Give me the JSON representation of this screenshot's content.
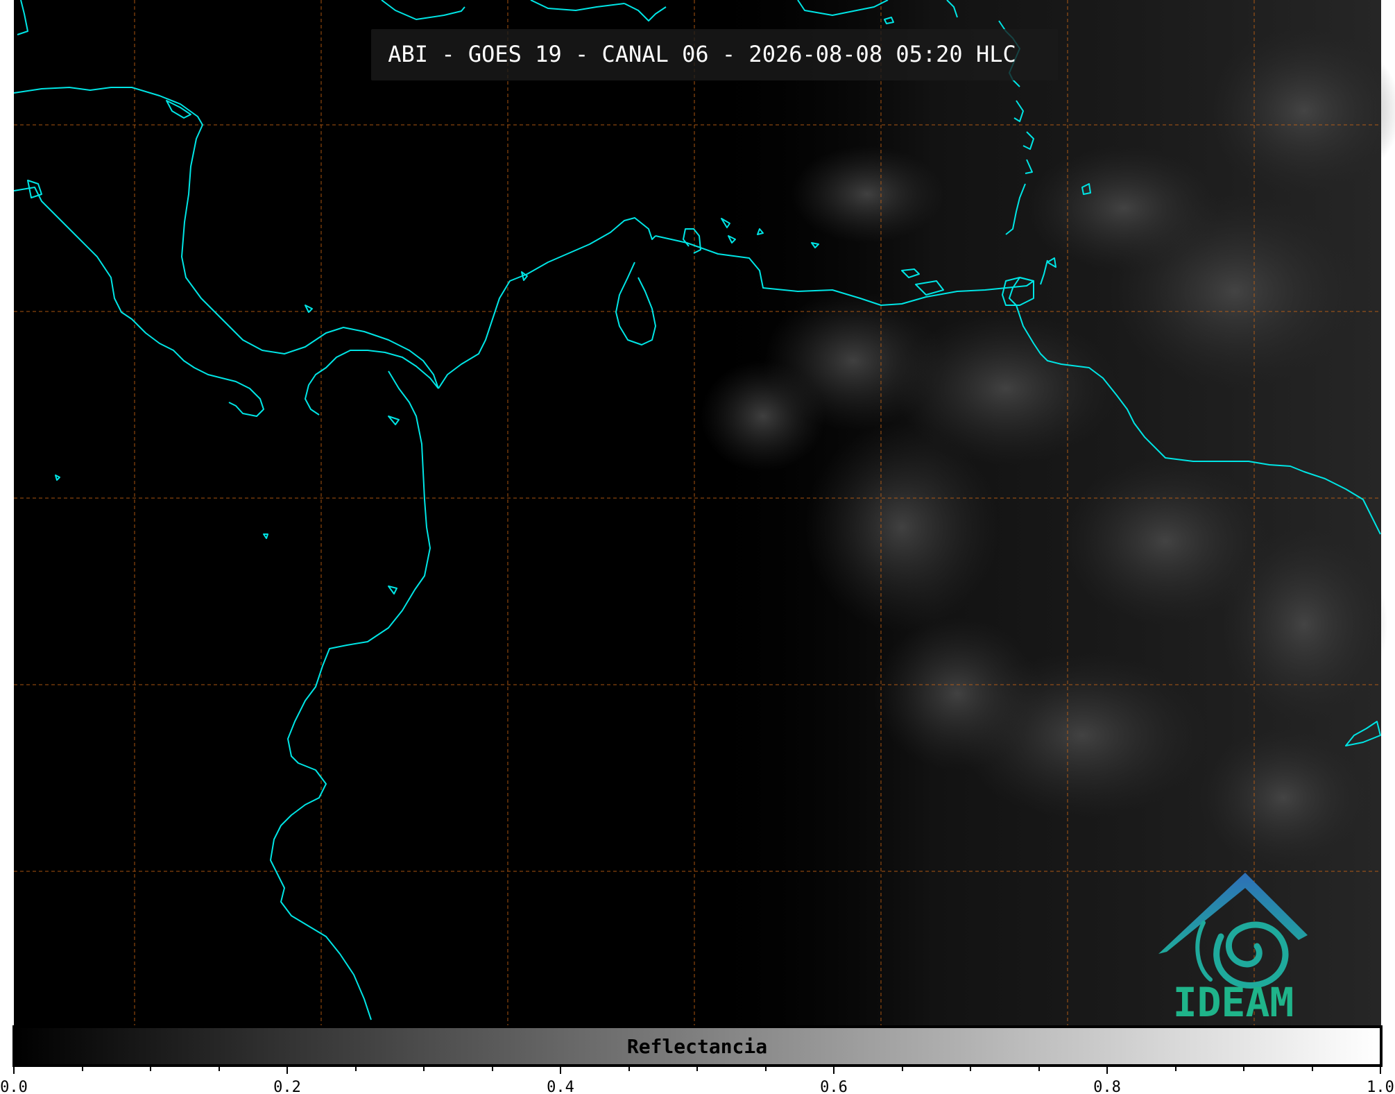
{
  "title": "ABI - GOES 19 - CANAL 06 - 2026-08-08 05:20 HLC",
  "colorbar": {
    "label": "Reflectancia",
    "ticks": [
      "0.0",
      "0.2",
      "0.4",
      "0.6",
      "0.8",
      "1.0"
    ],
    "range": [
      0.0,
      1.0
    ],
    "colormap": "grayscale black-to-white"
  },
  "logo": {
    "text": "IDEAM",
    "colors": {
      "text": "#1fb48a",
      "roof": "#2e6fb8",
      "swirl": "#1faa9c"
    }
  },
  "colors": {
    "background": "#000000",
    "coastline": "#00e5e5",
    "grid": "#c86414",
    "title_text": "#ffffff"
  },
  "grid": {
    "style": "dashed"
  }
}
